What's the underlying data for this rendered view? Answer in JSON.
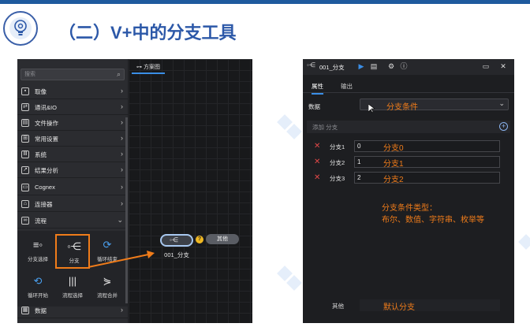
{
  "slide": {
    "title": "（二）V+中的分支工具",
    "colors": {
      "title": "#2c58a8",
      "accent_annotation": "#f07c1a",
      "highlight_box": "#f07c1a",
      "remove_icon": "#e24848",
      "active_tab": "#3a8ee6"
    },
    "logo_icon": "lightbulb-gear-icon"
  },
  "left": {
    "search_placeholder": "搜索",
    "categories": [
      {
        "label": "取像",
        "icon": "image-icon"
      },
      {
        "label": "通讯&IO",
        "icon": "connect-icon"
      },
      {
        "label": "文件操作",
        "icon": "file-icon"
      },
      {
        "label": "常用设置",
        "icon": "grid-icon"
      },
      {
        "label": "系统",
        "icon": "system-icon"
      },
      {
        "label": "结果分析",
        "icon": "chart-icon"
      },
      {
        "label": "Cognex",
        "icon": "cognex-icon"
      },
      {
        "label": "连接器",
        "icon": "plug-icon"
      },
      {
        "label": "流程",
        "icon": "flow-icon"
      }
    ],
    "tools": [
      {
        "label": "分支选择",
        "icon": "branch-select-icon"
      },
      {
        "label": "分支",
        "icon": "branch-icon"
      },
      {
        "label": "循环结束",
        "icon": "loop-end-icon"
      },
      {
        "label": "循环开始",
        "icon": "loop-start-icon"
      },
      {
        "label": "流程选择",
        "icon": "flow-select-icon"
      },
      {
        "label": "流程合并",
        "icon": "flow-merge-icon"
      }
    ],
    "bottom_category": {
      "label": "数据",
      "icon": "database-icon"
    },
    "canvas_tab": "方案图",
    "node_label": "001_分支",
    "output_label": "其他",
    "node_warning": "?"
  },
  "right": {
    "window_title": "001_分支",
    "tabs": [
      "属性",
      "输出"
    ],
    "data_label": "数据",
    "select_value": "分支条件",
    "add_branch": "添加 分支",
    "branches": [
      {
        "label": "分支1",
        "value": "0",
        "annotation": "分支0"
      },
      {
        "label": "分支2",
        "value": "1",
        "annotation": "分支1"
      },
      {
        "label": "分支3",
        "value": "2",
        "annotation": "分支2"
      }
    ],
    "note_line1": "分支条件类型：",
    "note_line2": "布尔、数值、字符串、枚举等",
    "other_label": "其他",
    "default_annotation": "默认分支"
  }
}
